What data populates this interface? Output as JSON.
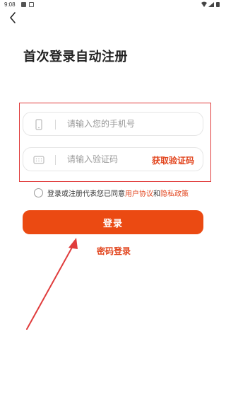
{
  "status_bar": {
    "time": "9:08",
    "icons": [
      "image-icon",
      "notification-icon",
      "wifi-icon",
      "signal-icon",
      "battery-icon"
    ]
  },
  "nav": {
    "back_icon": "chevron-left-icon"
  },
  "page": {
    "title": "首次登录自动注册"
  },
  "form": {
    "phone": {
      "placeholder": "请输入您的手机号",
      "value": "",
      "icon": "phone-icon"
    },
    "code": {
      "placeholder": "请输入验证码",
      "value": "",
      "icon": "keyboard-icon",
      "get_code_label": "获取验证码"
    },
    "agreement": {
      "checked": false,
      "prefix": "登录或注册代表您已同意",
      "user_agreement": "用户协议",
      "and": "和",
      "privacy_policy": "隐私政策"
    },
    "login_label": "登录",
    "password_login_label": "密码登录"
  },
  "colors": {
    "accent": "#eb4a12",
    "link": "#e2461f",
    "annotation": "#e03c3c",
    "text": "#222222",
    "placeholder": "#999999"
  }
}
